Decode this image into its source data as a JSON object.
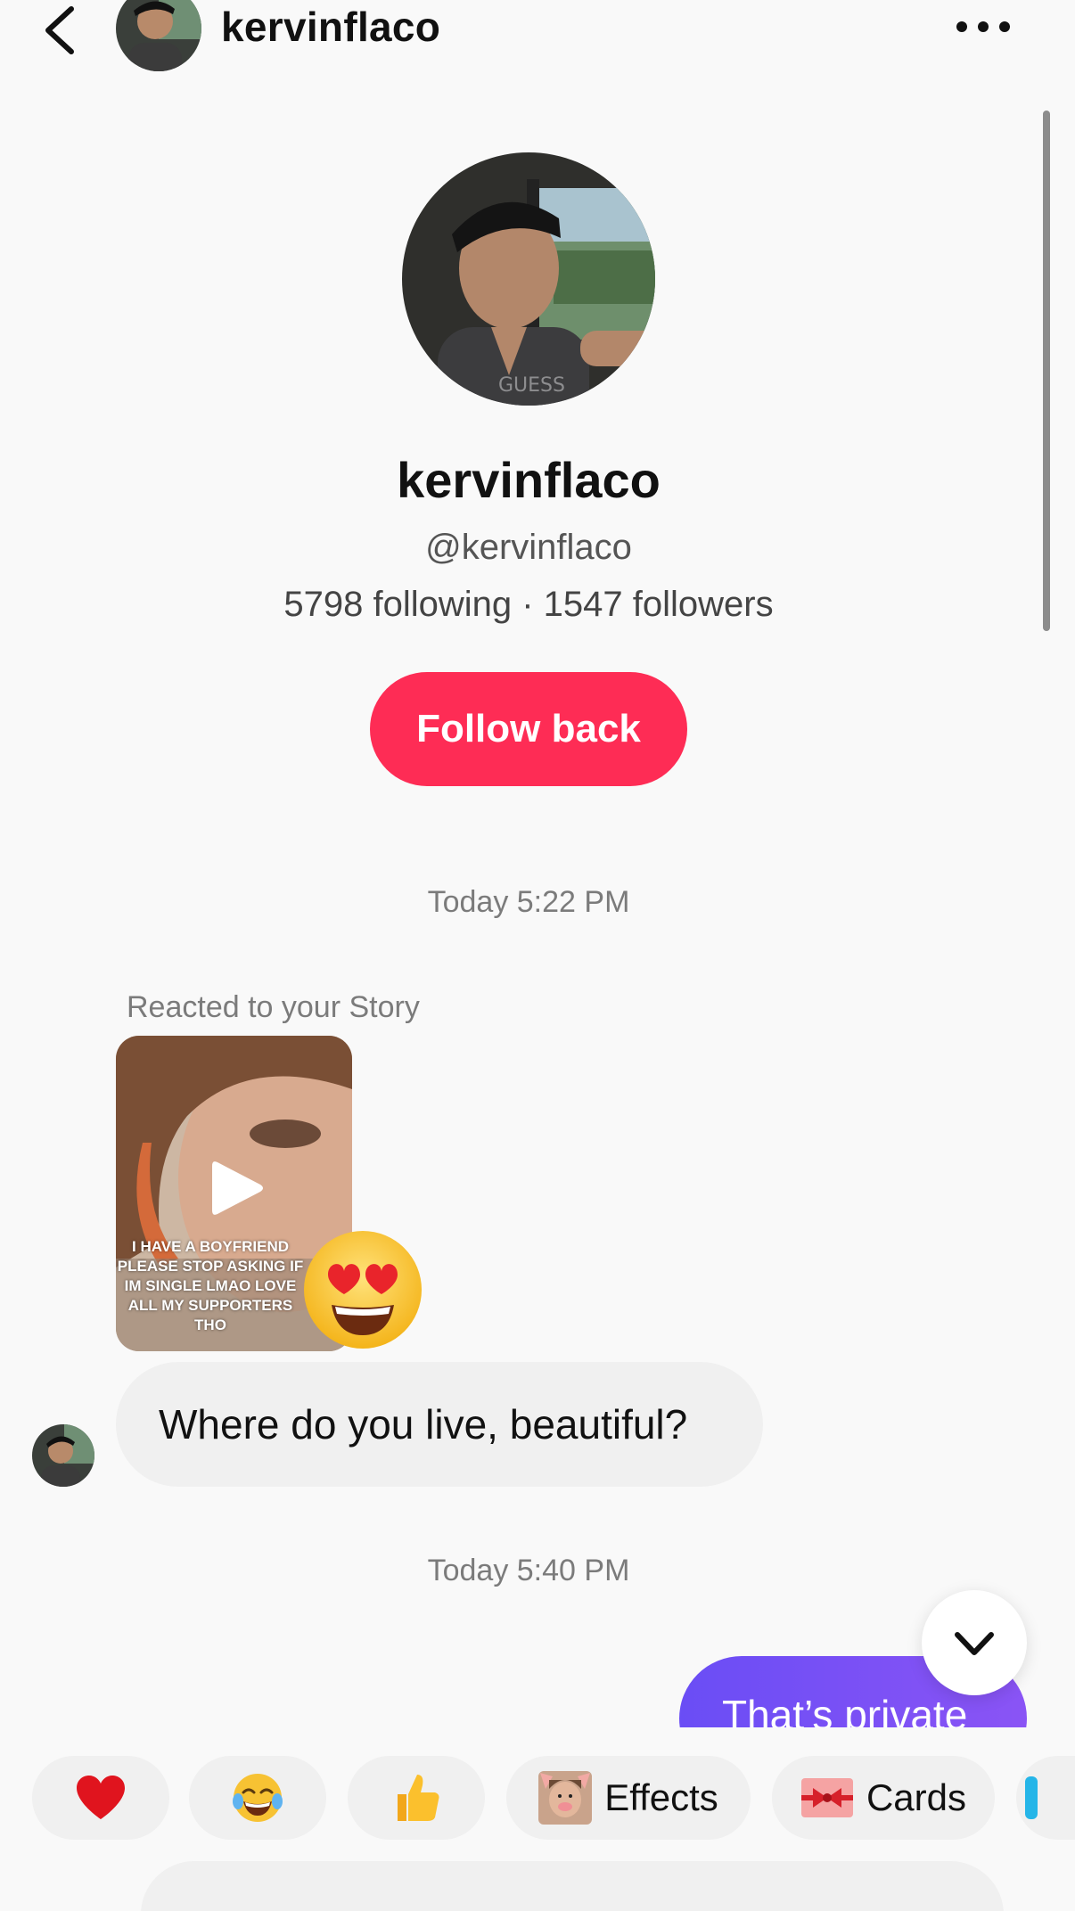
{
  "header": {
    "username": "kervinflaco"
  },
  "profile": {
    "display_name": "kervinflaco",
    "handle": "@kervinflaco",
    "stats": "5798 following · 1547 followers",
    "follow_button": "Follow back"
  },
  "messages": {
    "timestamp_1": "Today 5:22 PM",
    "reacted_label": "Reacted to your Story",
    "story_caption": "I HAVE A BOYFRIEND PLEASE STOP ASKING IF IM SINGLE LMAO LOVE ALL MY SUPPORTERS THO",
    "reaction_emoji": "heart-eyes",
    "incoming_text": "Where do you live, beautiful?",
    "timestamp_2": "Today 5:40 PM",
    "outgoing_text": "That’s private"
  },
  "quick_actions": [
    {
      "icon": "heart-icon",
      "label": ""
    },
    {
      "icon": "tears-of-joy-icon",
      "label": ""
    },
    {
      "icon": "thumbs-up-icon",
      "label": ""
    },
    {
      "icon": "pig-face-effect-icon",
      "label": "Effects"
    },
    {
      "icon": "gift-card-icon",
      "label": "Cards"
    }
  ],
  "colors": {
    "accent": "#fe2c55",
    "outgoing_bubble": "#6a4df5",
    "incoming_bubble": "#f0f0f0",
    "background": "#f9f9f9"
  }
}
